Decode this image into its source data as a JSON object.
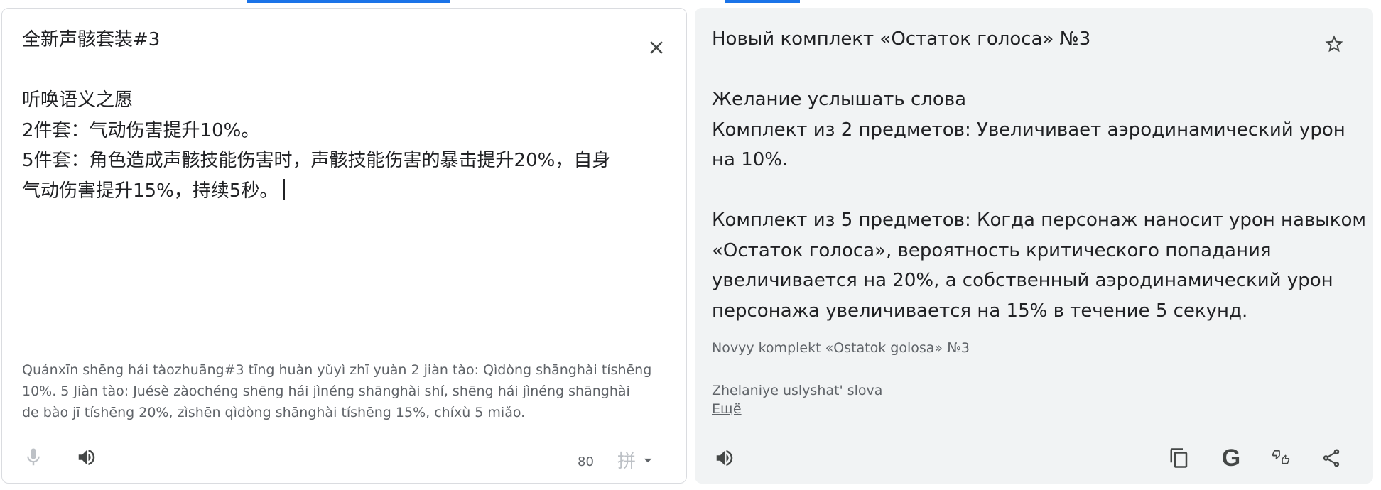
{
  "source": {
    "title": "全新声骸套装#3",
    "lines": [
      "听唤语义之愿",
      "2件套：气动伤害提升10%。",
      "5件套：角色造成声骸技能伤害时，声骸技能伤害的暴击提升20%，自身",
      "气动伤害提升15%，持续5秒。"
    ],
    "transliteration": [
      "Quánxīn shēng hái tàozhuāng#3 tīng huàn yǔyì zhī yuàn 2 jiàn tào: Qìdòng shānghài tíshēng",
      "10%. 5 Jiàn tào: Juésè zàochéng shēng hái jìnéng shānghài shí, shēng hái jìnéng shānghài",
      "de bào jī tíshēng 20%, zìshēn qìdòng shānghài tíshēng 15%, chíxù 5 miǎo."
    ],
    "char_count": "80",
    "input_tool": "拼"
  },
  "target": {
    "title": "Новый комплект «Остаток голоса» №3",
    "lines": [
      "Желание услышать слова",
      "Комплект из 2 предметов: Увеличивает аэродинамический урон",
      "на 10%.",
      "",
      "Комплект из 5 предметов: Когда персонаж наносит урон навыком",
      "«Остаток голоса», вероятность критического попадания",
      "увеличивается на 20%, а собственный аэродинамический урон",
      "персонажа увеличивается на 15% в течение 5 секунд."
    ],
    "transliteration": [
      "Novyy komplekt «Ostatok golosa» №3",
      "",
      "Zhelaniye uslyshat' slova"
    ],
    "more_label": "Ещё"
  },
  "icons": {
    "clear": "close-icon",
    "mic": "microphone-icon",
    "listen": "volume-icon",
    "star": "star-outline-icon",
    "copy": "copy-icon",
    "google": "google-g-icon",
    "feedback": "thumbs-feedback-icon",
    "share": "share-icon",
    "dropdown": "caret-down-icon"
  },
  "colors": {
    "accent": "#1a73e8",
    "target_bg": "#f1f3f4",
    "muted_text": "#5f6368"
  }
}
